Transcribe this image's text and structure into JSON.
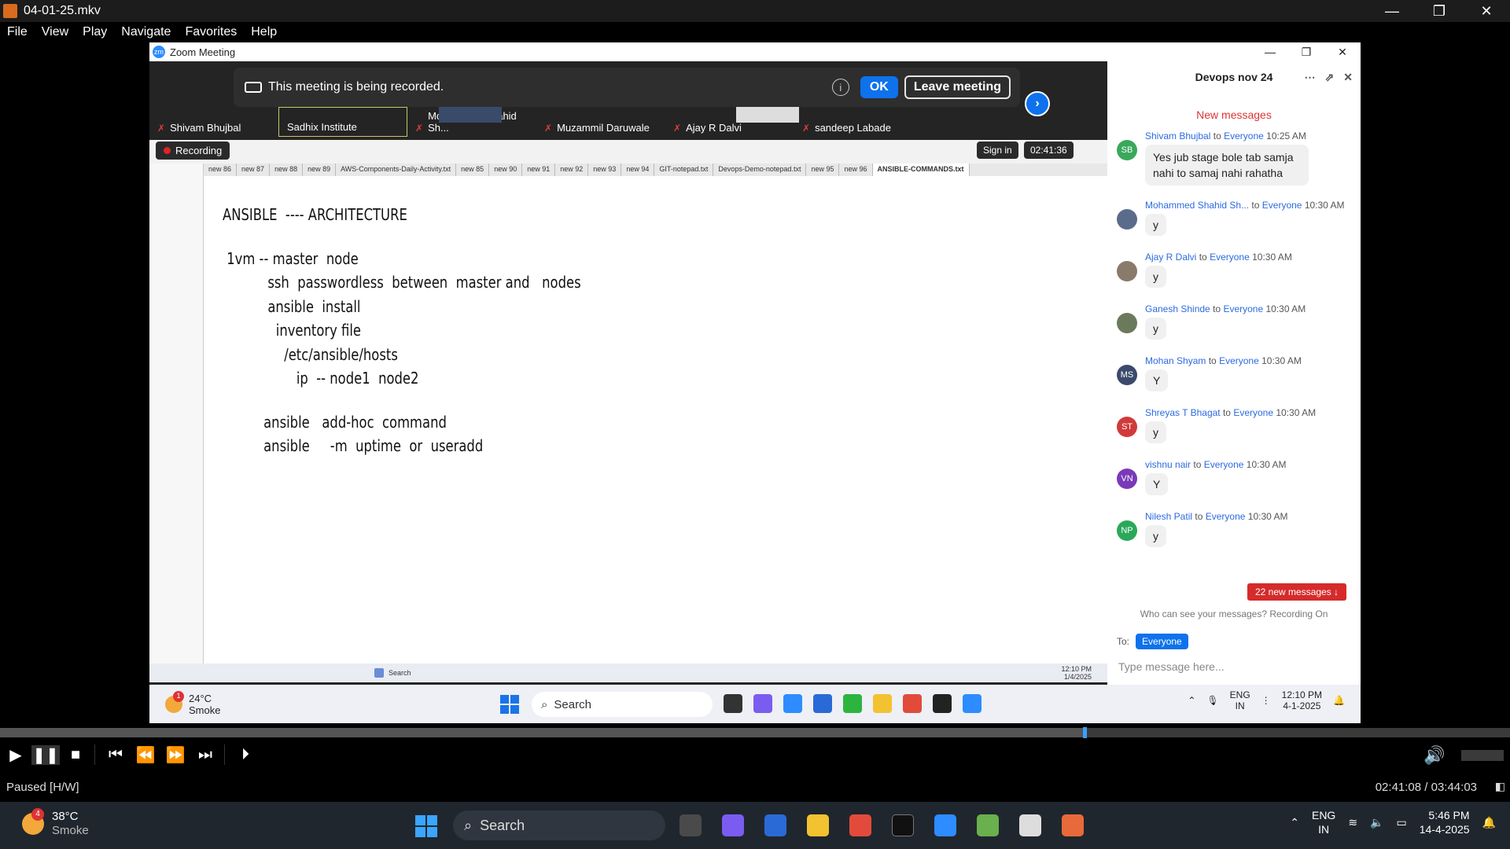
{
  "player": {
    "title": "04-01-25.mkv",
    "window_controls": [
      "—",
      "❐",
      "✕"
    ],
    "menu": [
      "File",
      "View",
      "Play",
      "Navigate",
      "Favorites",
      "Help"
    ],
    "status": "Paused [H/W]",
    "time": "02:41:08 / 03:44:03",
    "progress": 0.718
  },
  "zoom": {
    "title": "Zoom Meeting",
    "banner": {
      "text": "This meeting is being recorded.",
      "ok": "OK",
      "leave": "Leave meeting"
    },
    "participants": [
      {
        "name": "Shivam Bhujbal",
        "muted": true
      },
      {
        "name": "Sadhix Institute",
        "muted": false
      },
      {
        "name": "Mohammed Shahid Sh...",
        "muted": true
      },
      {
        "name": "Muzammil Daruwale",
        "muted": true
      },
      {
        "name": "Ajay R Dalvi",
        "muted": true
      },
      {
        "name": "sandeep Labade",
        "muted": true
      }
    ],
    "shared": {
      "recording_label": "Recording",
      "signin_label": "Sign in",
      "timer": "02:41:36",
      "tabs": [
        "new 86",
        "new 87",
        "new 88",
        "new 89",
        "AWS-Components-Daily-Activity.txt",
        "new 85",
        "new 90",
        "new 91",
        "new 92",
        "new 93",
        "new 94",
        "GIT-notepad.txt",
        "Devops-Demo-notepad.txt",
        "new 95",
        "new 96",
        "ANSIBLE-COMMANDS.txt"
      ],
      "document_lines": [
        "ANSIBLE  ---- ARCHITECTURE",
        "",
        " 1vm -- master  node",
        "           ssh  passwordless  between  master and   nodes",
        "           ansible  install",
        "             inventory file",
        "               /etc/ansible/hosts",
        "                  ip  -- node1  node2",
        "",
        "          ansible   add-hoc  command",
        "          ansible     -m  uptime  or  useradd"
      ],
      "taskbar_search": "Search",
      "taskbar_time": "12:10 PM",
      "taskbar_date": "1/4/2025"
    },
    "chat": {
      "title": "Devops nov 24",
      "new_messages_label": "New messages",
      "messages": [
        {
          "initials": "SB",
          "color": "#3aa85a",
          "name": "Shivam Bhujbal",
          "to": "to",
          "dest": "Everyone",
          "time": "10:25 AM",
          "text": "Yes jub stage bole tab samja nahi to samaj nahi rahatha"
        },
        {
          "initials": "",
          "color": "#5b6b8a",
          "name": "Mohammed Shahid Sh...",
          "to": "to",
          "dest": "Everyone",
          "time": "10:30 AM",
          "text": "y"
        },
        {
          "initials": "",
          "color": "#8a7a6b",
          "name": "Ajay R Dalvi",
          "to": "to",
          "dest": "Everyone",
          "time": "10:30 AM",
          "text": "y"
        },
        {
          "initials": "",
          "color": "#6b7a5b",
          "name": "Ganesh Shinde",
          "to": "to",
          "dest": "Everyone",
          "time": "10:30 AM",
          "text": "y"
        },
        {
          "initials": "MS",
          "color": "#3b4a6b",
          "name": "Mohan Shyam",
          "to": "to",
          "dest": "Everyone",
          "time": "10:30 AM",
          "text": "Y"
        },
        {
          "initials": "ST",
          "color": "#d13a3a",
          "name": "Shreyas T Bhagat",
          "to": "to",
          "dest": "Everyone",
          "time": "10:30 AM",
          "text": "y"
        },
        {
          "initials": "VN",
          "color": "#7a3ab8",
          "name": "vishnu nair",
          "to": "to",
          "dest": "Everyone",
          "time": "10:30 AM",
          "text": "Y"
        },
        {
          "initials": "NP",
          "color": "#2aa85a",
          "name": "Nilesh Patil",
          "to": "to",
          "dest": "Everyone",
          "time": "10:30 AM",
          "text": "y"
        }
      ],
      "new_count_button": "22 new messages ↓",
      "who_can_see": "Who can see your messages? Recording On",
      "to_label": "To:",
      "to_value": "Everyone",
      "input_placeholder": "Type message here..."
    },
    "rec_taskbar": {
      "temp": "24°C",
      "weather": "Smoke",
      "badge": "1",
      "search": "Search",
      "lang1": "ENG",
      "lang2": "IN",
      "time": "12:10 PM",
      "date": "4-1-2025"
    }
  },
  "host_taskbar": {
    "temp": "38°C",
    "weather": "Smoke",
    "badge": "4",
    "search": "Search",
    "lang1": "ENG",
    "lang2": "IN",
    "time": "5:46 PM",
    "date": "14-4-2025"
  },
  "colors": {
    "zoom_blue": "#0e72ed",
    "player_seek": "#3aa0ff",
    "alert_red": "#d52b2b"
  }
}
